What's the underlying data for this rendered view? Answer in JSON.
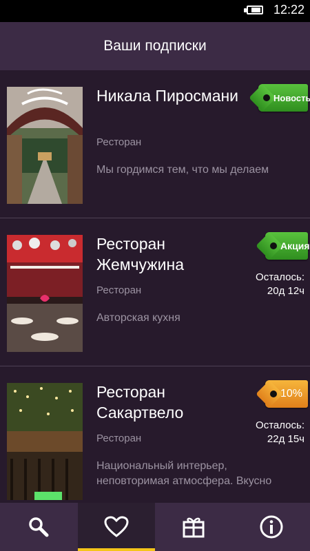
{
  "status_bar": {
    "time": "12:22"
  },
  "header": {
    "title": "Ваши подписки"
  },
  "subscriptions": [
    {
      "name": "Никала Пиросмани",
      "category": "Ресторан",
      "description": "Мы гордимся тем, что мы делаем",
      "tag": "Новость",
      "tag_color": "#3fa82a",
      "remaining_label": "",
      "remaining_value": ""
    },
    {
      "name": "Ресторан Жемчужина",
      "category": "Ресторан",
      "description": "Авторская кухня",
      "tag": "Акция",
      "tag_color": "#3fa82a",
      "remaining_label": "Осталось:",
      "remaining_value": "20д 12ч"
    },
    {
      "name": "Ресторан Сакартвело",
      "category": "Ресторан",
      "description": "Национальный интерьер, неповторимая атмосфера. Вкусно",
      "tag": "10%",
      "tag_color": "#ee9a28",
      "remaining_label": "Осталось:",
      "remaining_value": "22д 15ч"
    }
  ],
  "tabbar": {
    "tabs": [
      {
        "icon": "search-icon",
        "active": false
      },
      {
        "icon": "heart-icon",
        "active": true
      },
      {
        "icon": "gift-icon",
        "active": false
      },
      {
        "icon": "info-icon",
        "active": false
      }
    ],
    "accent": "#f4c51a"
  },
  "colors": {
    "background": "#271a2c",
    "header": "#3c2b45"
  }
}
